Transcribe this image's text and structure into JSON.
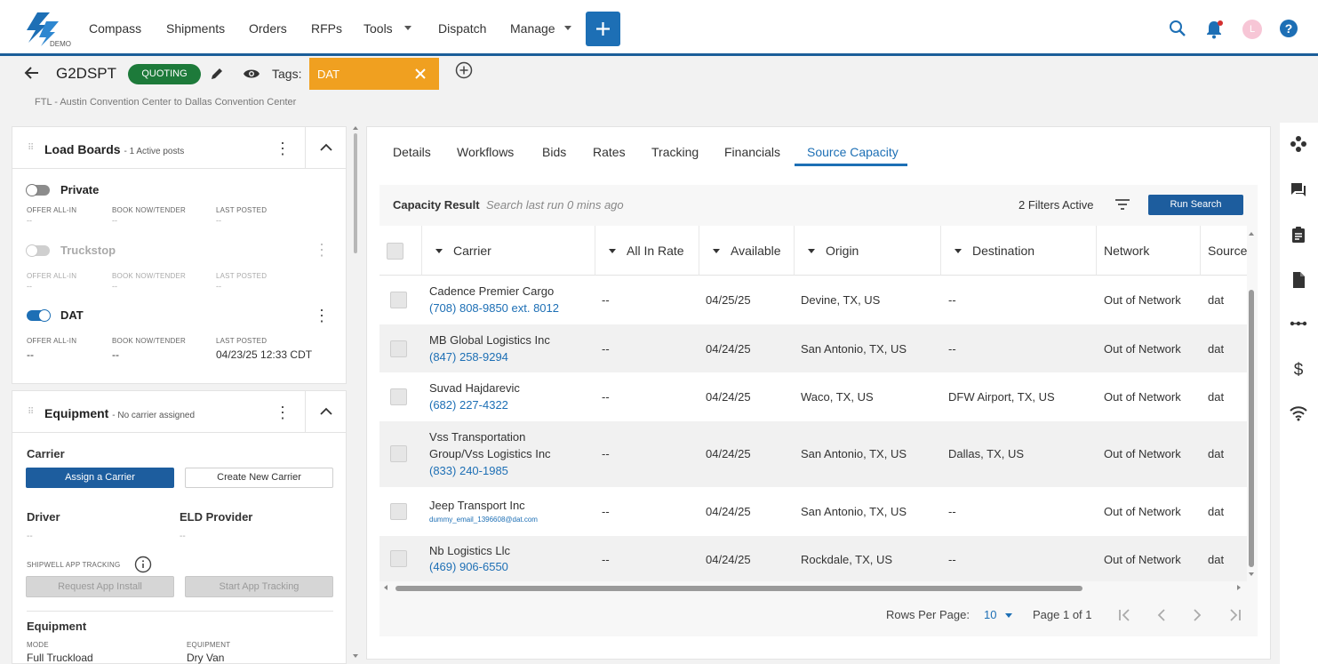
{
  "app": {
    "logo_badge": "DEMO",
    "nav": [
      "Compass",
      "Shipments",
      "Orders",
      "RFPs",
      "Tools",
      "Dispatch",
      "Manage"
    ],
    "avatar_initial": "L"
  },
  "header": {
    "shipment_id": "G2DSPT",
    "status": "QUOTING",
    "tags_label": "Tags:",
    "tag": "DAT",
    "route": "FTL - Austin Convention Center to Dallas Convention Center"
  },
  "load_boards": {
    "title": "Load Boards",
    "subtitle": "- 1 Active posts",
    "columns": [
      "OFFER ALL-IN",
      "BOOK NOW/TENDER",
      "LAST POSTED"
    ],
    "boards": [
      {
        "name": "Private",
        "offer": "--",
        "book": "--",
        "last": "--",
        "state": "off"
      },
      {
        "name": "Truckstop",
        "offer": "--",
        "book": "--",
        "last": "--",
        "state": "dim"
      },
      {
        "name": "DAT",
        "offer": "--",
        "book": "--",
        "last": "04/23/25 12:33 CDT",
        "state": "on"
      }
    ]
  },
  "equipment_card": {
    "title": "Equipment",
    "subtitle": "- No carrier assigned",
    "carrier_label": "Carrier",
    "assign_btn": "Assign a Carrier",
    "create_btn": "Create New Carrier",
    "driver_label": "Driver",
    "driver_value": "--",
    "eld_label": "ELD Provider",
    "eld_value": "--",
    "tracking_label": "SHIPWELL APP TRACKING",
    "request_btn": "Request App Install",
    "start_btn": "Start App Tracking",
    "equipment_label": "Equipment",
    "mode_label": "MODE",
    "mode_value": "Full Truckload",
    "equipment_type_label": "EQUIPMENT",
    "equipment_type_value": "Dry Van"
  },
  "tabs": [
    "Details",
    "Workflows",
    "Bids",
    "Rates",
    "Tracking",
    "Financials",
    "Source Capacity"
  ],
  "active_tab": "Source Capacity",
  "capacity": {
    "title": "Capacity Result",
    "subtitle": "Search last run 0 mins ago",
    "filters": "2 Filters Active",
    "run_search": "Run Search",
    "columns": [
      "Carrier",
      "All In Rate",
      "Available",
      "Origin",
      "Destination",
      "Network",
      "Source"
    ],
    "rows": [
      {
        "carrier": [
          "Cadence Premier Cargo"
        ],
        "contact": "(708) 808-9850 ext. 8012",
        "rate": "--",
        "available": "04/25/25",
        "origin": "Devine, TX, US",
        "destination": "--",
        "network": "Out of Network",
        "source": "dat"
      },
      {
        "carrier": [
          "MB Global Logistics Inc"
        ],
        "contact": "(847) 258-9294",
        "rate": "--",
        "available": "04/24/25",
        "origin": "San Antonio, TX, US",
        "destination": "--",
        "network": "Out of Network",
        "source": "dat"
      },
      {
        "carrier": [
          "Suvad Hajdarevic"
        ],
        "contact": "(682) 227-4322",
        "rate": "--",
        "available": "04/24/25",
        "origin": "Waco, TX, US",
        "destination": "DFW Airport, TX, US",
        "network": "Out of Network",
        "source": "dat"
      },
      {
        "carrier": [
          "Vss Transportation",
          "Group/Vss Logistics Inc"
        ],
        "contact": "(833) 240-1985",
        "rate": "--",
        "available": "04/24/25",
        "origin": "San Antonio, TX, US",
        "destination": "Dallas, TX, US",
        "network": "Out of Network",
        "source": "dat"
      },
      {
        "carrier": [
          "Jeep Transport Inc"
        ],
        "contact": "dummy_email_1396608@dat.com",
        "rate": "--",
        "available": "04/24/25",
        "origin": "San Antonio, TX, US",
        "destination": "--",
        "network": "Out of Network",
        "source": "dat"
      },
      {
        "carrier": [
          "Nb Logistics Llc"
        ],
        "contact": "(469) 906-6550",
        "rate": "--",
        "available": "04/24/25",
        "origin": "Rockdale, TX, US",
        "destination": "--",
        "network": "Out of Network",
        "source": "dat"
      }
    ],
    "rows_per_page_label": "Rows Per Page:",
    "rows_per_page": "10",
    "page_info": "Page 1 of 1"
  },
  "colors": {
    "accent": "#1d6fb5",
    "nav_accent": "#1b5e99",
    "status_green": "#1d7a3a",
    "tag_orange": "#f0a020"
  }
}
